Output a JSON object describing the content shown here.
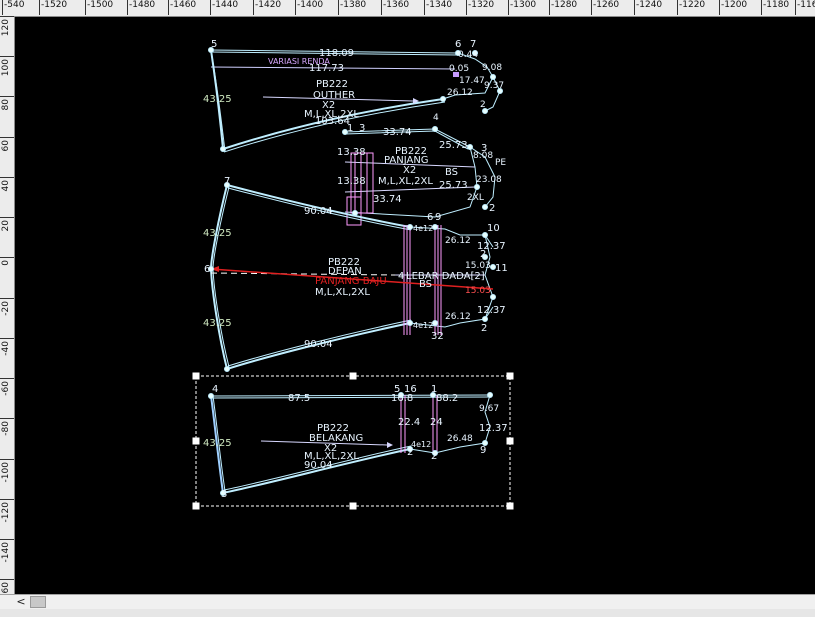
{
  "rulers": {
    "horizontal": [
      "-540",
      "-1520",
      "-1500",
      "-1480",
      "-1460",
      "-1440",
      "-1420",
      "-1400",
      "-1380",
      "-1360",
      "-1340",
      "-1320",
      "-1300",
      "-1280",
      "-1260",
      "-1240",
      "-1220",
      "-1200",
      "-1180",
      "-116"
    ],
    "vertical": [
      "120",
      "100",
      "80",
      "60",
      "40",
      "20",
      "0",
      "-20",
      "-40",
      "-60",
      "-80",
      "-100",
      "-120",
      "-140",
      "-160"
    ]
  },
  "scrollbar": {
    "left_arrow": "<"
  },
  "pieces": {
    "outher": {
      "name": "PB222",
      "part": "OUTHER",
      "qty": "X2",
      "sizes": "M,L,XL,2XL",
      "variasi": "VARIASI RENDA",
      "dims": {
        "top": "118.09",
        "top2": "117.73",
        "side": "43.25",
        "bottom": "103.64",
        "r1": "0.44",
        "r2": "0.05",
        "r3": "17.47",
        "r4": "9.08",
        "r5": "9.37",
        "r6": "26.12",
        "r7": "33.74",
        "r8": "25.73"
      },
      "points": [
        "5",
        "6",
        "7",
        "2",
        "4",
        "3"
      ]
    },
    "panjang": {
      "name": "PB222",
      "part": "PANJANG",
      "qty": "X2",
      "sizes": "M,L,XL,2XL",
      "dims": {
        "a": "13.38",
        "b": "13.38",
        "c": "33.74",
        "d": "25.73",
        "e": "25.73",
        "f": "8.08",
        "g": "23.08",
        "bs": "BS",
        "side1": "PE",
        "side2": "2XL"
      },
      "points": [
        "1",
        "3",
        "2",
        "3"
      ]
    },
    "depan": {
      "name": "PB222",
      "part": "DEPAN",
      "qty": "X2",
      "sizes": "M,L,XL,2XL",
      "baju_label": "PANJANG BAJU",
      "dada_label": "LEBAR DADA[2]",
      "dada_num": "4",
      "bs": "BS",
      "dims": {
        "side_top": "43.25",
        "side_bot": "43.25",
        "top_curve": "90.04",
        "bot_curve": "90.04",
        "r1": "26.12",
        "r2": "26.12",
        "r3": "12.37",
        "r4": "12.37",
        "r5": "15.03",
        "r6": "15.03",
        "hem1": "4e12",
        "hem2": "4e12"
      },
      "points": [
        "7",
        "6",
        "9",
        "10",
        "11",
        "2",
        "2",
        "3",
        "32",
        "2",
        "8",
        "6"
      ]
    },
    "belakang": {
      "name": "PB222",
      "part": "BELAKANG",
      "qty": "X2",
      "sizes": "M,L,XL,2XL",
      "dims": {
        "top": "87.5",
        "side": "43.25",
        "bottom": "90.04",
        "w1": "16.8",
        "w2": "88.2",
        "a": "22.4",
        "b": "24",
        "c": "26.48",
        "d": "9.67",
        "e": "12.37",
        "hem": "4e12"
      },
      "points": [
        "4",
        "5",
        "16",
        "1",
        "3",
        "2",
        "2",
        "9"
      ]
    }
  }
}
